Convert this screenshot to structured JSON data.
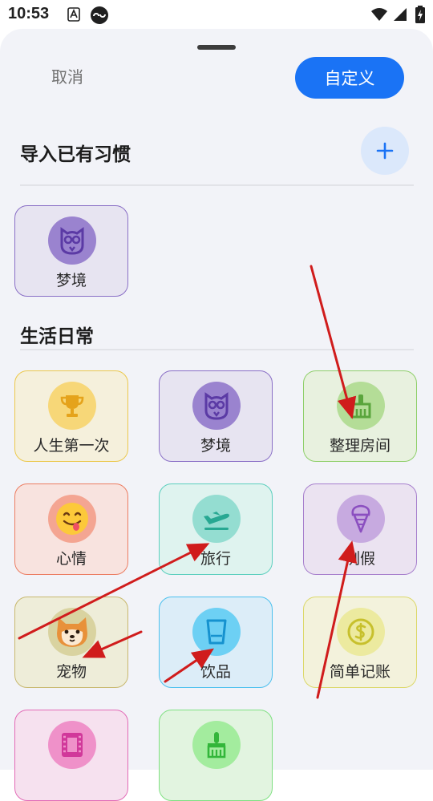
{
  "status_bar": {
    "time": "10:53"
  },
  "header": {
    "cancel_label": "取消",
    "custom_label": "自定义"
  },
  "import_section": {
    "title": "导入已有习惯",
    "items": [
      {
        "label": "梦境",
        "icon": "owl-icon"
      }
    ]
  },
  "life_section": {
    "title": "生活日常",
    "items": [
      {
        "label": "人生第一次",
        "icon": "trophy-icon"
      },
      {
        "label": "梦境",
        "icon": "owl-icon"
      },
      {
        "label": "整理房间",
        "icon": "broom-icon"
      },
      {
        "label": "心情",
        "icon": "smiley-icon"
      },
      {
        "label": "旅行",
        "icon": "plane-icon"
      },
      {
        "label": "例假",
        "icon": "ice-cream-icon"
      },
      {
        "label": "宠物",
        "icon": "shiba-dog-icon"
      },
      {
        "label": "饮品",
        "icon": "cup-icon"
      },
      {
        "label": "简单记账",
        "icon": "coin-icon"
      },
      {
        "label": "",
        "icon": "film-icon"
      },
      {
        "label": "",
        "icon": "brush-icon"
      }
    ]
  },
  "colors": {
    "accent": "#1a73f5",
    "annotation_arrow": "#d01c1c"
  }
}
